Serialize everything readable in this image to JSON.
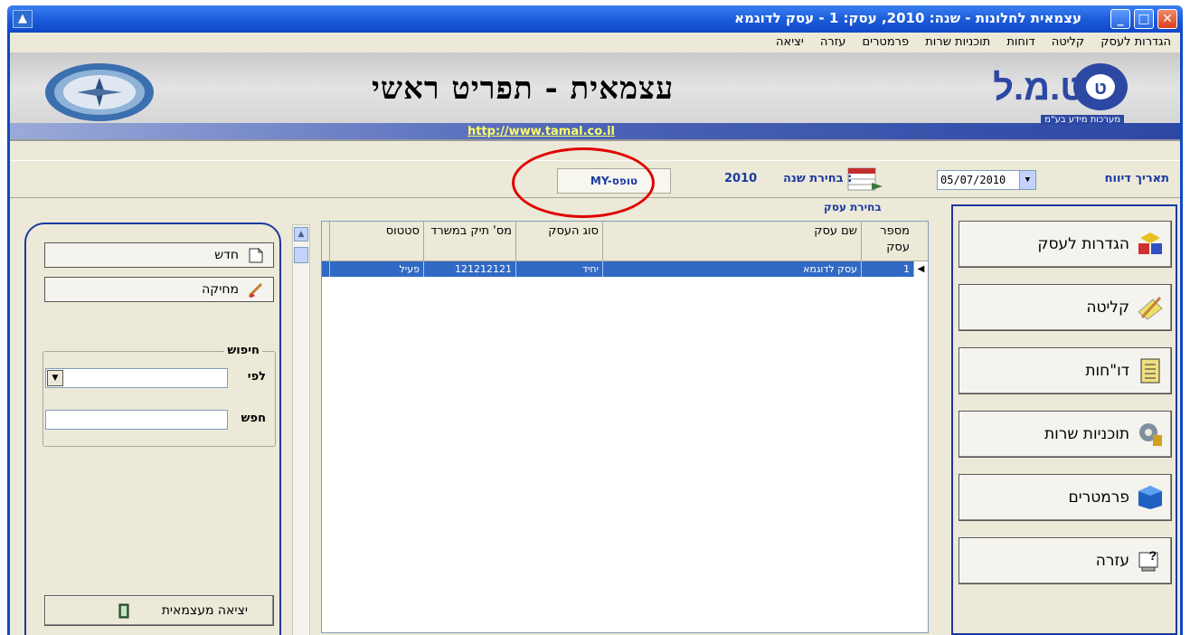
{
  "window": {
    "title": "עצמאית לחלונות - שנה: 2010, עסק: 1 - עסק לדוגמא"
  },
  "menu": [
    "הגדרות לעסק",
    "קליטה",
    "דוחות",
    "תוכניות שרות",
    "פרמטרים",
    "עזרה",
    "יציאה"
  ],
  "banner": {
    "heading": "עצמאית - תפריט ראשי",
    "url": "http://www.tamal.co.il",
    "logo_text": "ט.מ.ל",
    "logo_sub": "מערכות מידע בע\"מ"
  },
  "toolbar": {
    "date_label": "תאריך דיווח",
    "date_value": "05/07/2010",
    "year_label": "בחירת שנה :",
    "year_value": "2010",
    "mytofes_label": "MY-טופס"
  },
  "grid": {
    "section_title": "בחירת עסק",
    "columns": [
      {
        "key": "num",
        "label": "מספר עסק"
      },
      {
        "key": "name",
        "label": "שם עסק"
      },
      {
        "key": "type",
        "label": "סוג העסק"
      },
      {
        "key": "file",
        "label": "מס' תיק במשרד"
      },
      {
        "key": "status",
        "label": "סטטוס"
      }
    ],
    "rows": [
      {
        "num": "1",
        "name": "עסק לדוגמא",
        "type": "יחיד",
        "file": "121212121",
        "status": "פעיל"
      }
    ]
  },
  "nav": [
    {
      "label": "הגדרות לעסק",
      "icon": "blocks-icon"
    },
    {
      "label": "קליטה",
      "icon": "pencil-icon"
    },
    {
      "label": "דו\"חות",
      "icon": "report-icon"
    },
    {
      "label": "תוכניות שרות",
      "icon": "gear-icon"
    },
    {
      "label": "פרמטרים",
      "icon": "cube-icon"
    },
    {
      "label": "עזרה",
      "icon": "help-icon"
    }
  ],
  "left": {
    "new_label": "חדש",
    "delete_label": "מחיקה",
    "search_legend": "חיפוש",
    "by_label": "לפי",
    "search_label": "חפש",
    "exit_label": "יציאה מעצמאית"
  },
  "colors": {
    "title_blue": "#1048c6",
    "selection": "#316ac5",
    "highlight_circle": "#e00000"
  }
}
